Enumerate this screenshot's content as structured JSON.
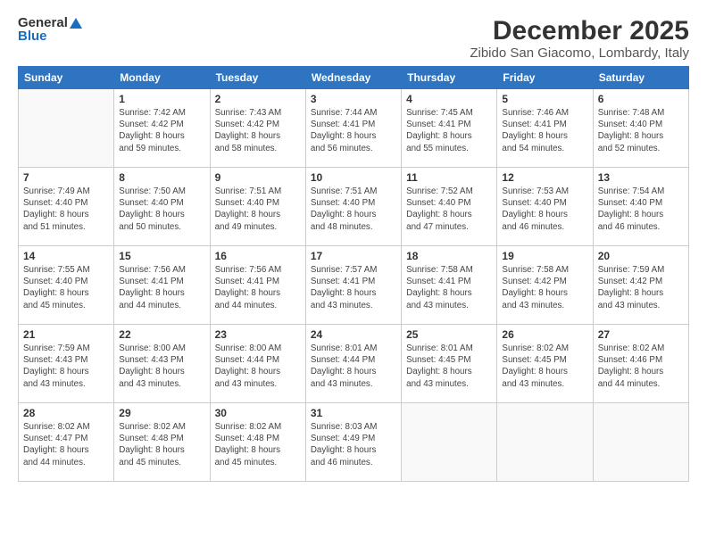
{
  "logo": {
    "line1": "General",
    "line2": "Blue"
  },
  "title": "December 2025",
  "location": "Zibido San Giacomo, Lombardy, Italy",
  "weekdays": [
    "Sunday",
    "Monday",
    "Tuesday",
    "Wednesday",
    "Thursday",
    "Friday",
    "Saturday"
  ],
  "weeks": [
    [
      {
        "day": "",
        "text": ""
      },
      {
        "day": "1",
        "text": "Sunrise: 7:42 AM\nSunset: 4:42 PM\nDaylight: 8 hours\nand 59 minutes."
      },
      {
        "day": "2",
        "text": "Sunrise: 7:43 AM\nSunset: 4:42 PM\nDaylight: 8 hours\nand 58 minutes."
      },
      {
        "day": "3",
        "text": "Sunrise: 7:44 AM\nSunset: 4:41 PM\nDaylight: 8 hours\nand 56 minutes."
      },
      {
        "day": "4",
        "text": "Sunrise: 7:45 AM\nSunset: 4:41 PM\nDaylight: 8 hours\nand 55 minutes."
      },
      {
        "day": "5",
        "text": "Sunrise: 7:46 AM\nSunset: 4:41 PM\nDaylight: 8 hours\nand 54 minutes."
      },
      {
        "day": "6",
        "text": "Sunrise: 7:48 AM\nSunset: 4:40 PM\nDaylight: 8 hours\nand 52 minutes."
      }
    ],
    [
      {
        "day": "7",
        "text": "Sunrise: 7:49 AM\nSunset: 4:40 PM\nDaylight: 8 hours\nand 51 minutes."
      },
      {
        "day": "8",
        "text": "Sunrise: 7:50 AM\nSunset: 4:40 PM\nDaylight: 8 hours\nand 50 minutes."
      },
      {
        "day": "9",
        "text": "Sunrise: 7:51 AM\nSunset: 4:40 PM\nDaylight: 8 hours\nand 49 minutes."
      },
      {
        "day": "10",
        "text": "Sunrise: 7:51 AM\nSunset: 4:40 PM\nDaylight: 8 hours\nand 48 minutes."
      },
      {
        "day": "11",
        "text": "Sunrise: 7:52 AM\nSunset: 4:40 PM\nDaylight: 8 hours\nand 47 minutes."
      },
      {
        "day": "12",
        "text": "Sunrise: 7:53 AM\nSunset: 4:40 PM\nDaylight: 8 hours\nand 46 minutes."
      },
      {
        "day": "13",
        "text": "Sunrise: 7:54 AM\nSunset: 4:40 PM\nDaylight: 8 hours\nand 46 minutes."
      }
    ],
    [
      {
        "day": "14",
        "text": "Sunrise: 7:55 AM\nSunset: 4:40 PM\nDaylight: 8 hours\nand 45 minutes."
      },
      {
        "day": "15",
        "text": "Sunrise: 7:56 AM\nSunset: 4:41 PM\nDaylight: 8 hours\nand 44 minutes."
      },
      {
        "day": "16",
        "text": "Sunrise: 7:56 AM\nSunset: 4:41 PM\nDaylight: 8 hours\nand 44 minutes."
      },
      {
        "day": "17",
        "text": "Sunrise: 7:57 AM\nSunset: 4:41 PM\nDaylight: 8 hours\nand 43 minutes."
      },
      {
        "day": "18",
        "text": "Sunrise: 7:58 AM\nSunset: 4:41 PM\nDaylight: 8 hours\nand 43 minutes."
      },
      {
        "day": "19",
        "text": "Sunrise: 7:58 AM\nSunset: 4:42 PM\nDaylight: 8 hours\nand 43 minutes."
      },
      {
        "day": "20",
        "text": "Sunrise: 7:59 AM\nSunset: 4:42 PM\nDaylight: 8 hours\nand 43 minutes."
      }
    ],
    [
      {
        "day": "21",
        "text": "Sunrise: 7:59 AM\nSunset: 4:43 PM\nDaylight: 8 hours\nand 43 minutes."
      },
      {
        "day": "22",
        "text": "Sunrise: 8:00 AM\nSunset: 4:43 PM\nDaylight: 8 hours\nand 43 minutes."
      },
      {
        "day": "23",
        "text": "Sunrise: 8:00 AM\nSunset: 4:44 PM\nDaylight: 8 hours\nand 43 minutes."
      },
      {
        "day": "24",
        "text": "Sunrise: 8:01 AM\nSunset: 4:44 PM\nDaylight: 8 hours\nand 43 minutes."
      },
      {
        "day": "25",
        "text": "Sunrise: 8:01 AM\nSunset: 4:45 PM\nDaylight: 8 hours\nand 43 minutes."
      },
      {
        "day": "26",
        "text": "Sunrise: 8:02 AM\nSunset: 4:45 PM\nDaylight: 8 hours\nand 43 minutes."
      },
      {
        "day": "27",
        "text": "Sunrise: 8:02 AM\nSunset: 4:46 PM\nDaylight: 8 hours\nand 44 minutes."
      }
    ],
    [
      {
        "day": "28",
        "text": "Sunrise: 8:02 AM\nSunset: 4:47 PM\nDaylight: 8 hours\nand 44 minutes."
      },
      {
        "day": "29",
        "text": "Sunrise: 8:02 AM\nSunset: 4:48 PM\nDaylight: 8 hours\nand 45 minutes."
      },
      {
        "day": "30",
        "text": "Sunrise: 8:02 AM\nSunset: 4:48 PM\nDaylight: 8 hours\nand 45 minutes."
      },
      {
        "day": "31",
        "text": "Sunrise: 8:03 AM\nSunset: 4:49 PM\nDaylight: 8 hours\nand 46 minutes."
      },
      {
        "day": "",
        "text": ""
      },
      {
        "day": "",
        "text": ""
      },
      {
        "day": "",
        "text": ""
      }
    ]
  ]
}
